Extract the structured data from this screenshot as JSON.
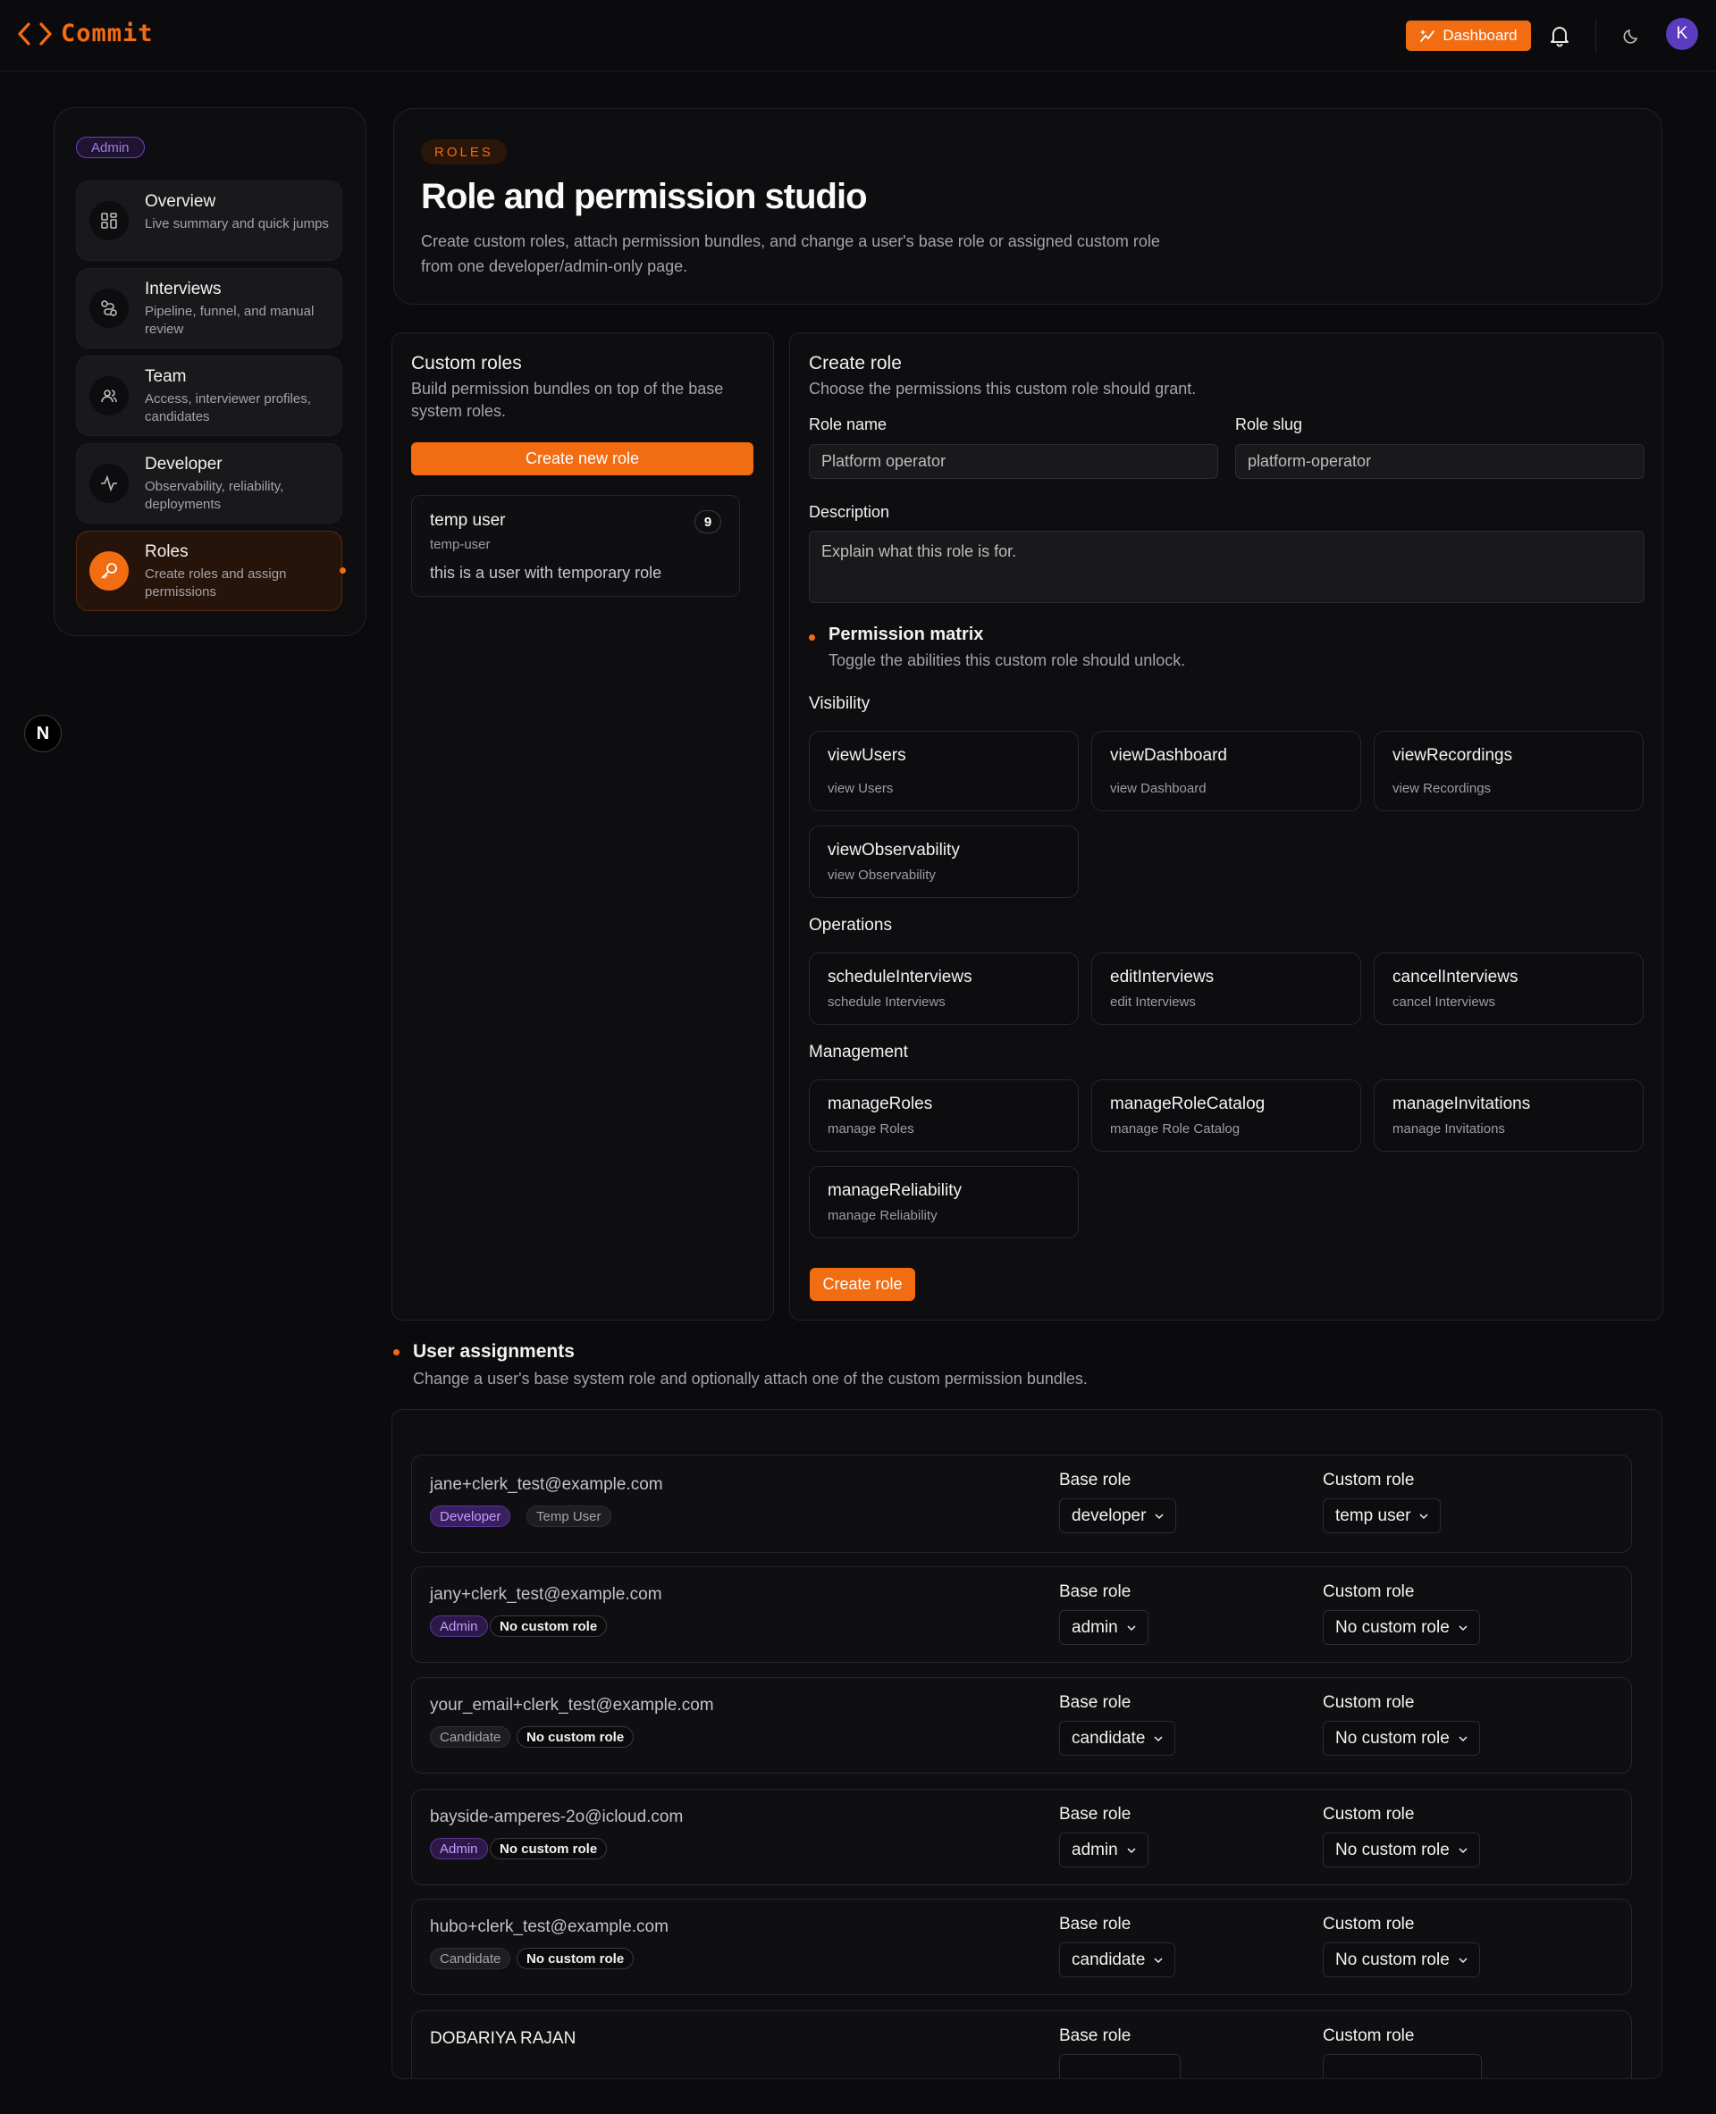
{
  "app": {
    "name": "Commit"
  },
  "header": {
    "dashboard_label": "Dashboard",
    "avatar_initial": "K"
  },
  "sidebar": {
    "badge": "Admin",
    "items": [
      {
        "title": "Overview",
        "desc": "Live summary and quick jumps",
        "icon": "grid-icon",
        "active": false
      },
      {
        "title": "Interviews",
        "desc": "Pipeline, funnel, and manual review",
        "icon": "route-icon",
        "active": false
      },
      {
        "title": "Team",
        "desc": "Access, interviewer profiles, candidates",
        "icon": "users-icon",
        "active": false
      },
      {
        "title": "Developer",
        "desc": "Observability, reliability, deployments",
        "icon": "activity-icon",
        "active": false
      },
      {
        "title": "Roles",
        "desc": "Create roles and assign permissions",
        "icon": "key-icon",
        "active": true
      }
    ]
  },
  "page": {
    "eyebrow": "ROLES",
    "title": "Role and permission studio",
    "desc": "Create custom roles, attach permission bundles, and change a user's base role or assigned custom role from one developer/admin-only page."
  },
  "custom_roles": {
    "title": "Custom roles",
    "desc": "Build permission bundles on top of the base system roles.",
    "create_label": "Create new role",
    "roles": [
      {
        "name": "temp user",
        "slug": "temp-user",
        "desc": "this is a user with temporary role",
        "count": "9"
      }
    ]
  },
  "create_role": {
    "title": "Create role",
    "desc": "Choose the permissions this custom role should grant.",
    "name_label": "Role name",
    "name_placeholder": "Platform operator",
    "slug_label": "Role slug",
    "slug_placeholder": "platform-operator",
    "desc_label": "Description",
    "desc_placeholder": "Explain what this role is for.",
    "matrix_title": "Permission matrix",
    "matrix_desc": "Toggle the abilities this custom role should unlock.",
    "groups": [
      {
        "title": "Visibility",
        "perms": [
          {
            "name": "viewUsers",
            "desc": "view Users"
          },
          {
            "name": "viewDashboard",
            "desc": "view Dashboard"
          },
          {
            "name": "viewRecordings",
            "desc": "view Recordings"
          },
          {
            "name": "viewObservability",
            "desc": "view Observability"
          }
        ]
      },
      {
        "title": "Operations",
        "perms": [
          {
            "name": "scheduleInterviews",
            "desc": "schedule Interviews"
          },
          {
            "name": "editInterviews",
            "desc": "edit Interviews"
          },
          {
            "name": "cancelInterviews",
            "desc": "cancel Interviews"
          }
        ]
      },
      {
        "title": "Management",
        "perms": [
          {
            "name": "manageRoles",
            "desc": "manage Roles"
          },
          {
            "name": "manageRoleCatalog",
            "desc": "manage Role Catalog"
          },
          {
            "name": "manageInvitations",
            "desc": "manage Invitations"
          },
          {
            "name": "manageReliability",
            "desc": "manage Reliability"
          }
        ]
      }
    ],
    "submit_label": "Create role"
  },
  "assignments": {
    "title": "User assignments",
    "desc": "Change a user's base system role and optionally attach one of the custom permission bundles.",
    "base_label": "Base role",
    "custom_label": "Custom role",
    "users": [
      {
        "email": "jane+clerk_test@example.com",
        "role_tag": "Developer",
        "custom_tag": "Temp User",
        "base": "developer",
        "custom": "temp user"
      },
      {
        "email": "jany+clerk_test@example.com",
        "role_tag": "Admin",
        "custom_tag": "No custom role",
        "base": "admin",
        "custom": "No custom role"
      },
      {
        "email": "your_email+clerk_test@example.com",
        "role_tag": "Candidate",
        "custom_tag": "No custom role",
        "base": "candidate",
        "custom": "No custom role"
      },
      {
        "email": "bayside-amperes-2o@icloud.com",
        "role_tag": "Admin",
        "custom_tag": "No custom role",
        "base": "admin",
        "custom": "No custom role"
      },
      {
        "email": "hubo+clerk_test@example.com",
        "role_tag": "Candidate",
        "custom_tag": "No custom role",
        "base": "candidate",
        "custom": "No custom role"
      },
      {
        "email": "DOBARIYA RAJAN",
        "role_tag": "",
        "custom_tag": "",
        "base": "",
        "custom": ""
      }
    ]
  },
  "colors": {
    "accent": "#f26c12",
    "background": "#0b0b0d",
    "purple": "#6d3fc9"
  }
}
